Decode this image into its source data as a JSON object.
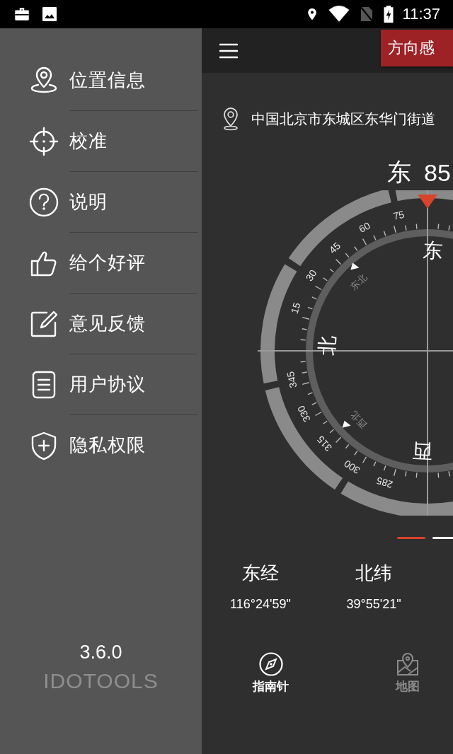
{
  "status_bar": {
    "time": "11:37"
  },
  "drawer": {
    "items": [
      {
        "label": "位置信息",
        "kind": "pin"
      },
      {
        "label": "校准",
        "kind": "crosshair"
      },
      {
        "label": "说明",
        "kind": "question"
      },
      {
        "label": "给个好评",
        "kind": "thumb"
      },
      {
        "label": "意见反馈",
        "kind": "edit"
      },
      {
        "label": "用户协议",
        "kind": "document"
      },
      {
        "label": "隐私权限",
        "kind": "shield"
      }
    ],
    "version": "3.6.0",
    "brand": "IDOTOOLS"
  },
  "toolbar": {
    "tab_button": "方向感"
  },
  "location": {
    "address": "中国北京市东城区东华门街道"
  },
  "heading": {
    "direction": "东",
    "degrees": "85"
  },
  "compass": {
    "cardinals": [
      "北",
      "东",
      "西"
    ],
    "intercardinals": [
      "东北",
      "西北"
    ],
    "dial_numbers": [
      "75",
      "60",
      "45",
      "30",
      "15",
      "345",
      "330",
      "315",
      "300",
      "285"
    ]
  },
  "page_indicator": [
    {
      "selected": true
    },
    {
      "selected": false
    }
  ],
  "coordinates": [
    {
      "label": "东经",
      "value": "116°24'59\""
    },
    {
      "label": "北纬",
      "value": "39°55'21\""
    }
  ],
  "bottom_nav": [
    {
      "label": "指南针",
      "kind": "compass",
      "selected": true
    },
    {
      "label": "地图",
      "kind": "map",
      "selected": false
    }
  ]
}
